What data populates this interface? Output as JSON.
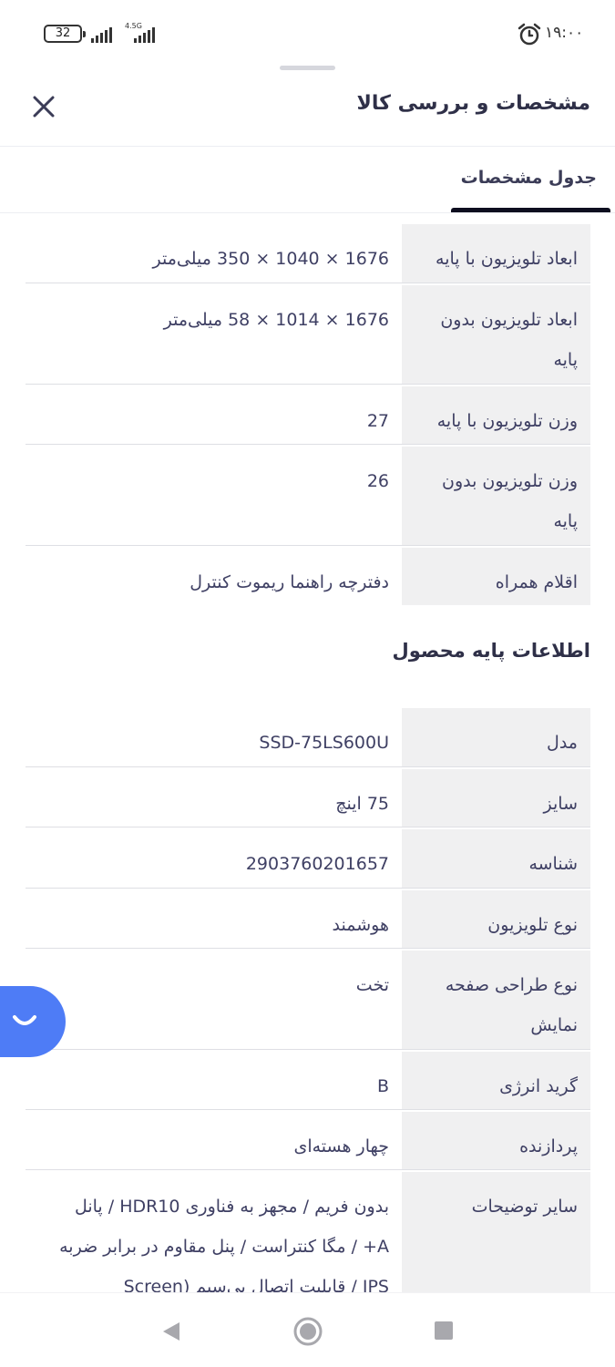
{
  "status_bar": {
    "battery_level": "32",
    "network_type": "4.5G",
    "time": "۱۹:۰۰"
  },
  "sheet": {
    "title": "مشخصات و بررسی کالا",
    "close_icon": "close-icon",
    "tab_label": "جدول مشخصات"
  },
  "specs": [
    {
      "label": [
        "ابعاد تلویزیون با پایه"
      ],
      "value": [
        "1676 × 1040 × 350 میلی‌متر"
      ]
    },
    {
      "label": [
        "ابعاد تلویزیون بدون",
        "پایه"
      ],
      "value": [
        "1676 × 1014 × 58 میلی‌متر"
      ]
    },
    {
      "label": [
        "وزن تلویزیون با پایه"
      ],
      "value": [
        "27"
      ]
    },
    {
      "label": [
        "وزن تلویزیون بدون",
        "پایه"
      ],
      "value": [
        "26"
      ]
    },
    {
      "label": [
        "اقلام همراه"
      ],
      "value": [
        "دفترچه راهنما ریموت کنترل"
      ]
    }
  ],
  "basic_info": {
    "title": "اطلاعات پایه محصول",
    "rows": [
      {
        "label": [
          "مدل"
        ],
        "value": [
          "SSD-75LS600U"
        ]
      },
      {
        "label": [
          "سایز"
        ],
        "value": [
          "75 اینچ"
        ]
      },
      {
        "label": [
          "شناسه"
        ],
        "value": [
          "2903760201657"
        ]
      },
      {
        "label": [
          "نوع تلویزیون"
        ],
        "value": [
          "هوشمند"
        ]
      },
      {
        "label": [
          "نوع طراحی صفحه",
          "نمایش"
        ],
        "value": [
          "تخت"
        ]
      },
      {
        "label": [
          "گرید انرژی"
        ],
        "value": [
          "B"
        ]
      },
      {
        "label": [
          "پردازنده"
        ],
        "value": [
          "چهار هسته‌ای"
        ]
      },
      {
        "label": [
          "سایر توضیحات"
        ],
        "value": [
          "بدون فریم / مجهز به فناوری HDR10 / پانل",
          "A+ / مگا کنتراست / پنل مقاوم در برابر ضربه",
          "IPS / قابلیت اتصال بی‌سیم (Screen"
        ]
      }
    ]
  },
  "icons": {
    "chat": "chat-smile-icon",
    "back": "nav-back-icon",
    "home": "nav-home-icon",
    "recent": "nav-recent-icon"
  },
  "colors": {
    "accent": "#4e7cf6",
    "label_bg": "#f0f0f1",
    "text": "#3f4064"
  }
}
